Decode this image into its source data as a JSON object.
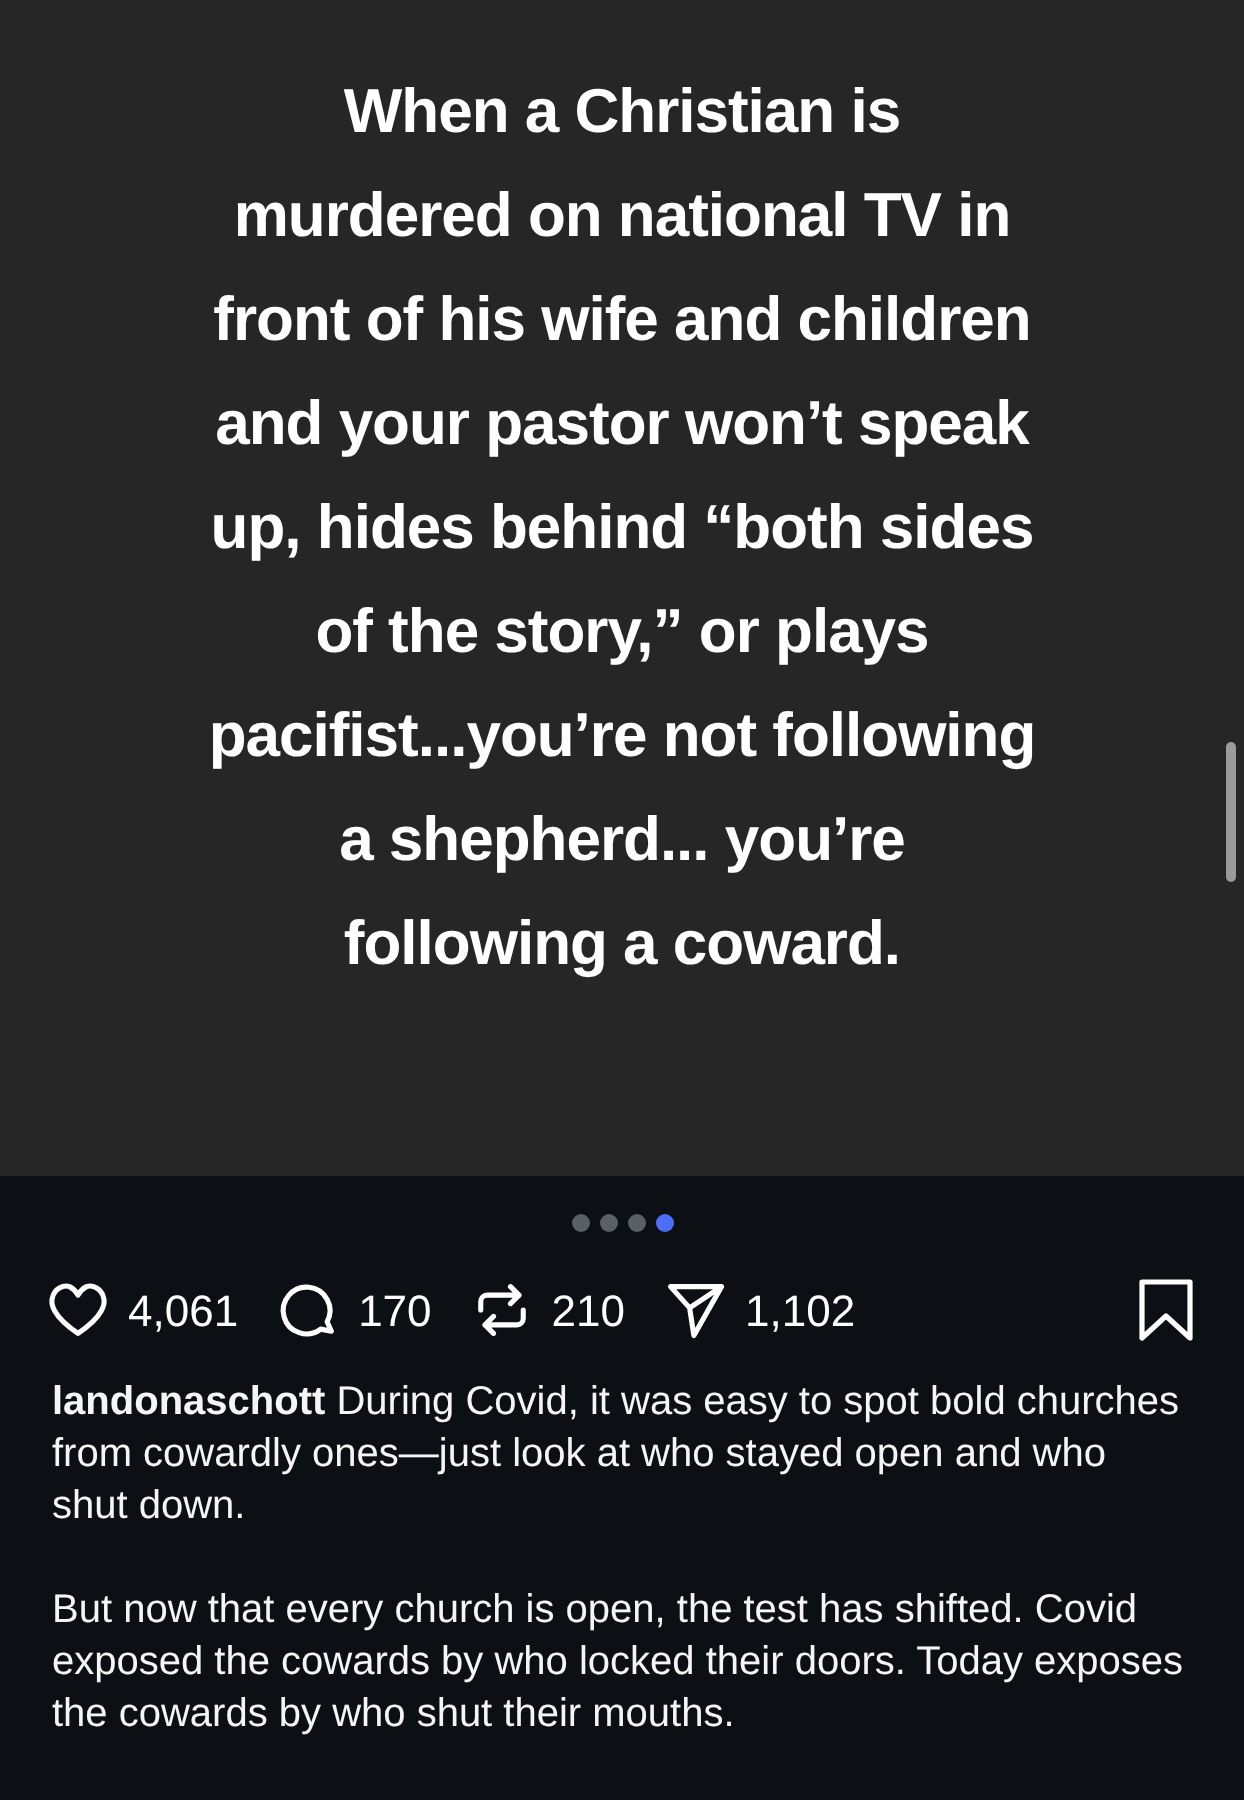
{
  "post": {
    "quote": "When a Christian is\nmurdered on national TV in\nfront of his wife and children\nand your pastor won’t speak\nup, hides behind “both sides\nof the story,” or plays\npacifist...you’re not following\na shepherd... you’re\nfollowing a coward.",
    "pages": [
      {
        "selected": false
      },
      {
        "selected": false
      },
      {
        "selected": false
      },
      {
        "selected": true
      }
    ]
  },
  "actions": [
    {
      "kind": "like",
      "count": "4,061"
    },
    {
      "kind": "comment",
      "count": "170"
    },
    {
      "kind": "repost",
      "count": "210"
    },
    {
      "kind": "share",
      "count": "1,102"
    }
  ],
  "saved": false,
  "caption": {
    "username": "landonaschott",
    "paragraphs": [
      "During Covid, it was easy to spot bold churches from cowardly ones—just look at who stayed open and who shut down.",
      "But now that every church is open, the test has shifted. Covid exposed the cowards by who locked their doors. Today exposes the cowards by who shut their mouths."
    ]
  }
}
